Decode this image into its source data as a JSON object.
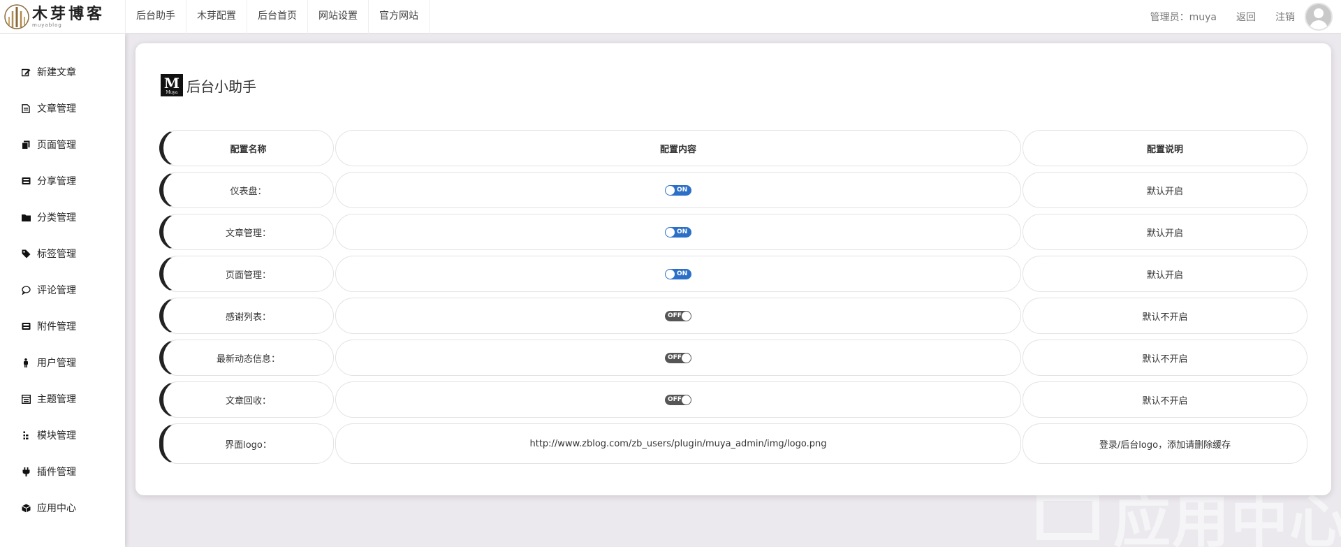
{
  "header": {
    "logo_title": "木芽博客",
    "logo_sub": "muyablog",
    "nav": [
      "后台助手",
      "木芽配置",
      "后台首页",
      "网站设置",
      "官方网站"
    ],
    "admin_label": "管理员：muya",
    "back_label": "返回",
    "logout_label": "注销"
  },
  "sidebar": {
    "items": [
      {
        "label": "新建文章",
        "icon": "pencil-square-icon"
      },
      {
        "label": "文章管理",
        "icon": "file-text-icon"
      },
      {
        "label": "页面管理",
        "icon": "copy-icon"
      },
      {
        "label": "分享管理",
        "icon": "share-box-icon"
      },
      {
        "label": "分类管理",
        "icon": "folder-icon"
      },
      {
        "label": "标签管理",
        "icon": "tag-icon"
      },
      {
        "label": "评论管理",
        "icon": "comment-icon"
      },
      {
        "label": "附件管理",
        "icon": "attachment-box-icon"
      },
      {
        "label": "用户管理",
        "icon": "user-icon"
      },
      {
        "label": "主题管理",
        "icon": "theme-icon"
      },
      {
        "label": "模块管理",
        "icon": "module-icon"
      },
      {
        "label": "插件管理",
        "icon": "plug-icon"
      },
      {
        "label": "应用中心",
        "icon": "cube-icon"
      }
    ]
  },
  "card": {
    "logo_letter": "M",
    "logo_small": "Muya",
    "title": "后台小助手",
    "headers": [
      "配置名称",
      "配置内容",
      "配置说明"
    ],
    "rows": [
      {
        "name": "仪表盘：",
        "toggle": "ON",
        "desc": "默认开启"
      },
      {
        "name": "文章管理：",
        "toggle": "ON",
        "desc": "默认开启"
      },
      {
        "name": "页面管理：",
        "toggle": "ON",
        "desc": "默认开启"
      },
      {
        "name": "感谢列表：",
        "toggle": "OFF",
        "desc": "默认不开启"
      },
      {
        "name": "最新动态信息：",
        "toggle": "OFF",
        "desc": "默认不开启"
      },
      {
        "name": "文章回收：",
        "toggle": "OFF",
        "desc": "默认不开启"
      }
    ],
    "logo_row": {
      "name": "界面logo：",
      "value": "http://www.zblog.com/zb_users/plugin/muya_admin/img/logo.png",
      "desc": "登录/后台logo，添加请删除缓存"
    }
  },
  "watermark": "应用中心"
}
